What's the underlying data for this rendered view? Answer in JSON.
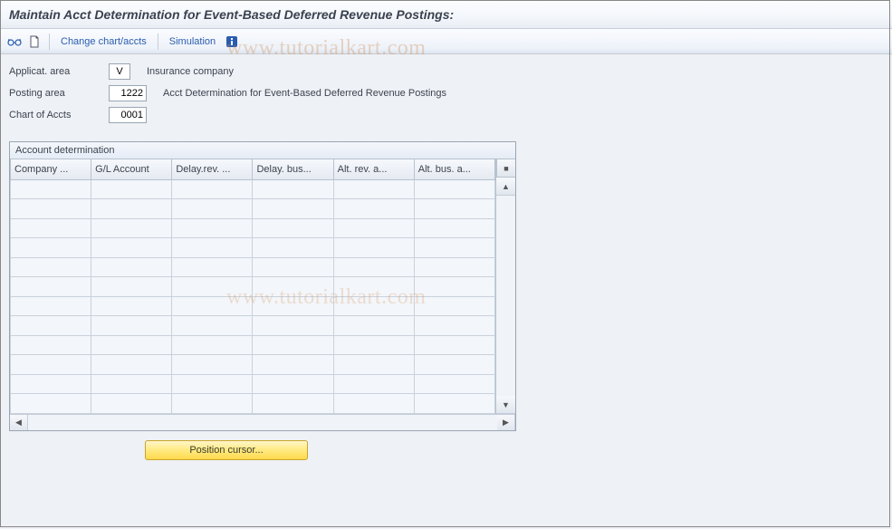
{
  "page_title": "Maintain Acct Determination for Event-Based Deferred Revenue Postings:",
  "toolbar": {
    "change_chart_label": "Change chart/accts",
    "simulation_label": "Simulation"
  },
  "form": {
    "applicat_area": {
      "label": "Applicat. area",
      "value": "V",
      "desc": "Insurance company"
    },
    "posting_area": {
      "label": "Posting area",
      "value": "1222",
      "desc": "Acct Determination for Event-Based Deferred Revenue Postings"
    },
    "chart_of_accts": {
      "label": "Chart of Accts",
      "value": "0001",
      "desc": ""
    }
  },
  "grid": {
    "title": "Account determination",
    "columns": [
      "Company ...",
      "G/L Account",
      "Delay.rev. ...",
      "Delay. bus...",
      "Alt. rev. a...",
      "Alt. bus. a..."
    ],
    "row_count": 12
  },
  "position_button": "Position cursor...",
  "watermark": "www.tutorialkart.com"
}
